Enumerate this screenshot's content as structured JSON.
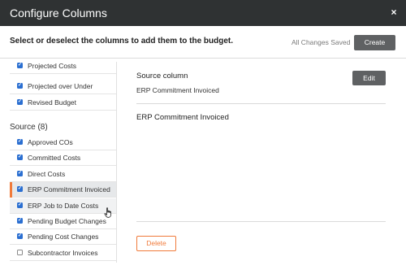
{
  "header": {
    "title": "Configure Columns",
    "close_icon": "×"
  },
  "toolbar": {
    "instructions": "Select or deselect the columns to add them to the budget.",
    "status": "All Changes Saved",
    "create_label": "Create"
  },
  "list": {
    "upper_items": [
      {
        "label": "Projected Costs",
        "checked": true
      },
      {
        "label": "Projected over Under",
        "checked": true
      },
      {
        "label": "Revised Budget",
        "checked": true
      }
    ],
    "section_heading": "Source (8)",
    "source_items": [
      {
        "label": "Approved COs",
        "checked": true
      },
      {
        "label": "Committed Costs",
        "checked": true
      },
      {
        "label": "Direct Costs",
        "checked": true
      },
      {
        "label": "ERP Commitment Invoiced",
        "checked": true,
        "selected": true
      },
      {
        "label": "ERP Job to Date Costs",
        "checked": true
      },
      {
        "label": "Pending Budget Changes",
        "checked": true
      },
      {
        "label": "Pending Cost Changes",
        "checked": true
      },
      {
        "label": "Subcontractor Invoices",
        "checked": false
      }
    ]
  },
  "detail": {
    "source_column_label": "Source column",
    "source_column_value": "ERP Commitment Invoiced",
    "edit_label": "Edit",
    "title": "ERP Commitment Invoiced",
    "delete_label": "Delete"
  },
  "colors": {
    "header_bg": "#2f3233",
    "accent_orange": "#f07a3a",
    "checkbox_blue": "#2b6fd1",
    "button_gray": "#5f6163"
  }
}
